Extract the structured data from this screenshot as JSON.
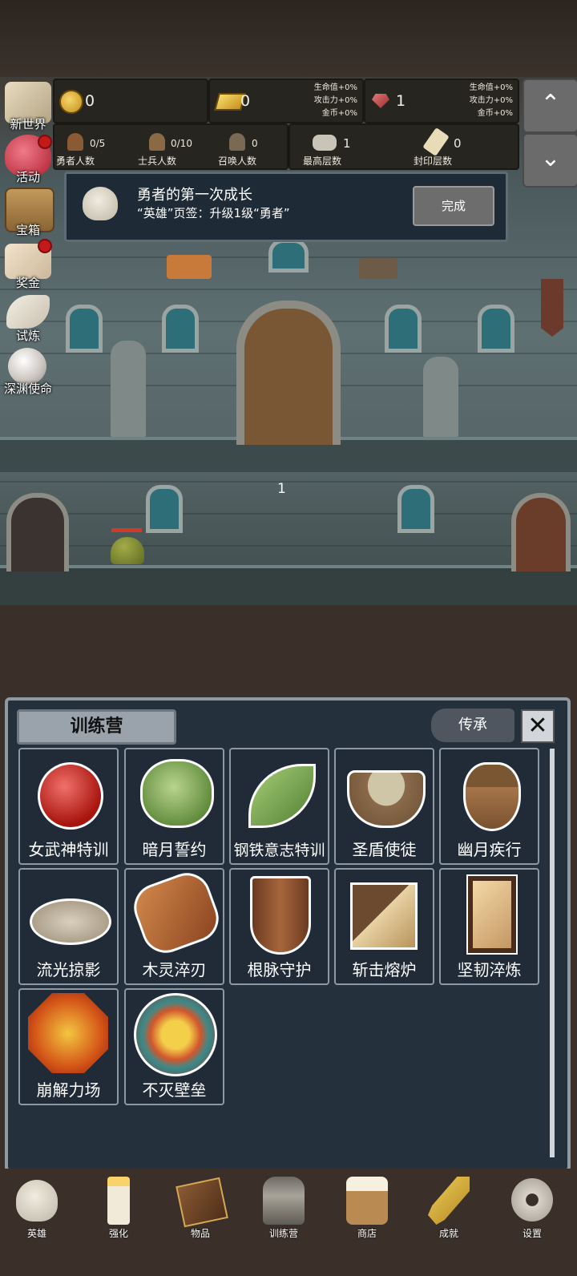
{
  "resources": {
    "coins": "0",
    "gold": "0",
    "gold_bonus": [
      "生命值+0%",
      "攻击力+0%",
      "金币+0%"
    ],
    "gems": "1",
    "gem_bonus": [
      "生命值+0%",
      "攻击力+0%",
      "金币+0%"
    ]
  },
  "counts": {
    "heroes": {
      "value": "0/5",
      "label": "勇者人数"
    },
    "soldiers": {
      "value": "0/10",
      "label": "士兵人数"
    },
    "summons": {
      "value": "0",
      "label": "召唤人数"
    },
    "max_floor": {
      "value": "1",
      "label": "最高层数"
    },
    "seal_floor": {
      "value": "0",
      "label": "封印层数"
    }
  },
  "side_menu": [
    {
      "label": "新世界",
      "icon": "map-icon",
      "badge": false
    },
    {
      "label": "活动",
      "icon": "heart-icon",
      "badge": true
    },
    {
      "label": "宝箱",
      "icon": "chest-icon",
      "badge": false
    },
    {
      "label": "奖金",
      "icon": "envelope-icon",
      "badge": true
    },
    {
      "label": "试炼",
      "icon": "wing-icon",
      "badge": false
    },
    {
      "label": "深渊使命",
      "icon": "orb-icon",
      "badge": false
    }
  ],
  "scroll_buttons": {
    "up": "⌃",
    "down": "⌄"
  },
  "quest": {
    "title": "勇者的第一次成长",
    "desc": "“英雄”页签：升级1级“勇者”",
    "button": "完成"
  },
  "scene": {
    "floor_number": "1"
  },
  "training": {
    "title": "训练营",
    "inherit_button": "传承",
    "close": "✕",
    "items": [
      {
        "label": "女武神特训",
        "icon": "apple-icon"
      },
      {
        "label": "暗月誓约",
        "icon": "cabbage-icon"
      },
      {
        "label": "钢铁意志特训",
        "icon": "leaf-icon"
      },
      {
        "label": "圣盾使徒",
        "icon": "bowl-icon"
      },
      {
        "label": "幽月疾行",
        "icon": "acorn-icon"
      },
      {
        "label": "流光掠影",
        "icon": "bread-icon"
      },
      {
        "label": "木灵淬刃",
        "icon": "log-icon"
      },
      {
        "label": "根脉守护",
        "icon": "wooden-shield-icon"
      },
      {
        "label": "斩击熔炉",
        "icon": "crate-icon"
      },
      {
        "label": "坚韧淬炼",
        "icon": "tower-shield-icon"
      },
      {
        "label": "崩解力场",
        "icon": "lava-shield-icon"
      },
      {
        "label": "不灭壁垒",
        "icon": "sun-shield-icon"
      }
    ]
  },
  "nav": [
    {
      "label": "英雄",
      "icon": "skull-icon"
    },
    {
      "label": "强化",
      "icon": "candle-icon"
    },
    {
      "label": "物品",
      "icon": "book-icon"
    },
    {
      "label": "训练营",
      "icon": "lantern-icon"
    },
    {
      "label": "商店",
      "icon": "beer-mug-icon"
    },
    {
      "label": "成就",
      "icon": "key-icon"
    },
    {
      "label": "设置",
      "icon": "gear-icon"
    }
  ],
  "colors": {
    "panel": "#25303d",
    "panel_border": "#8e99a4",
    "badge": "#c31919"
  }
}
